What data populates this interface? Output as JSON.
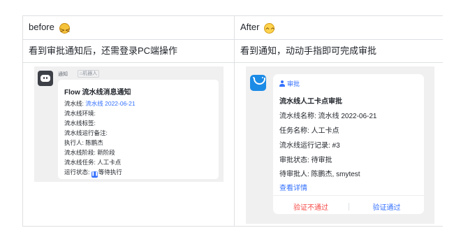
{
  "table": {
    "header_left": "before",
    "header_left_emoji": "tired-face-emoji",
    "header_right": "After",
    "header_right_emoji": "smiling-face-emoji",
    "row1_left": "看到审批通知后，还需登录PC端操作",
    "row1_right": "看到通知，动动手指即可完成审批"
  },
  "before_card": {
    "sender": "通知",
    "sender_tag": "机器人",
    "title": "Flow 流水线消息通知",
    "pipeline_label": "流水线:",
    "pipeline_link": "流水线 2022-06-21",
    "env": "流水线环境:",
    "tag": "流水线标签:",
    "remark": "流水线运行备注:",
    "executor": "执行人: 陈鹏杰",
    "stage": "流水线阶段: 新阶段",
    "task": "流水线任务: 人工卡点",
    "status_label": "运行状态:",
    "status_value": "等待执行"
  },
  "after_card": {
    "tag": "审批",
    "title": "流水线人工卡点审批",
    "name": "流水线名称: 流水线 2022-06-21",
    "task": "任务名称: 人工卡点",
    "run": "流水线运行记录: #3",
    "status": "审批状态: 待审批",
    "approvers": "待审批人: 陈鹏杰, smytest",
    "detail_link": "查看详情",
    "reject_button": "验证不通过",
    "approve_button": "验证通过"
  },
  "colors": {
    "accent": "#3370ff",
    "danger": "#f54a45",
    "border": "#dee0e3",
    "screenshot_bg": "#f0f0f1"
  }
}
